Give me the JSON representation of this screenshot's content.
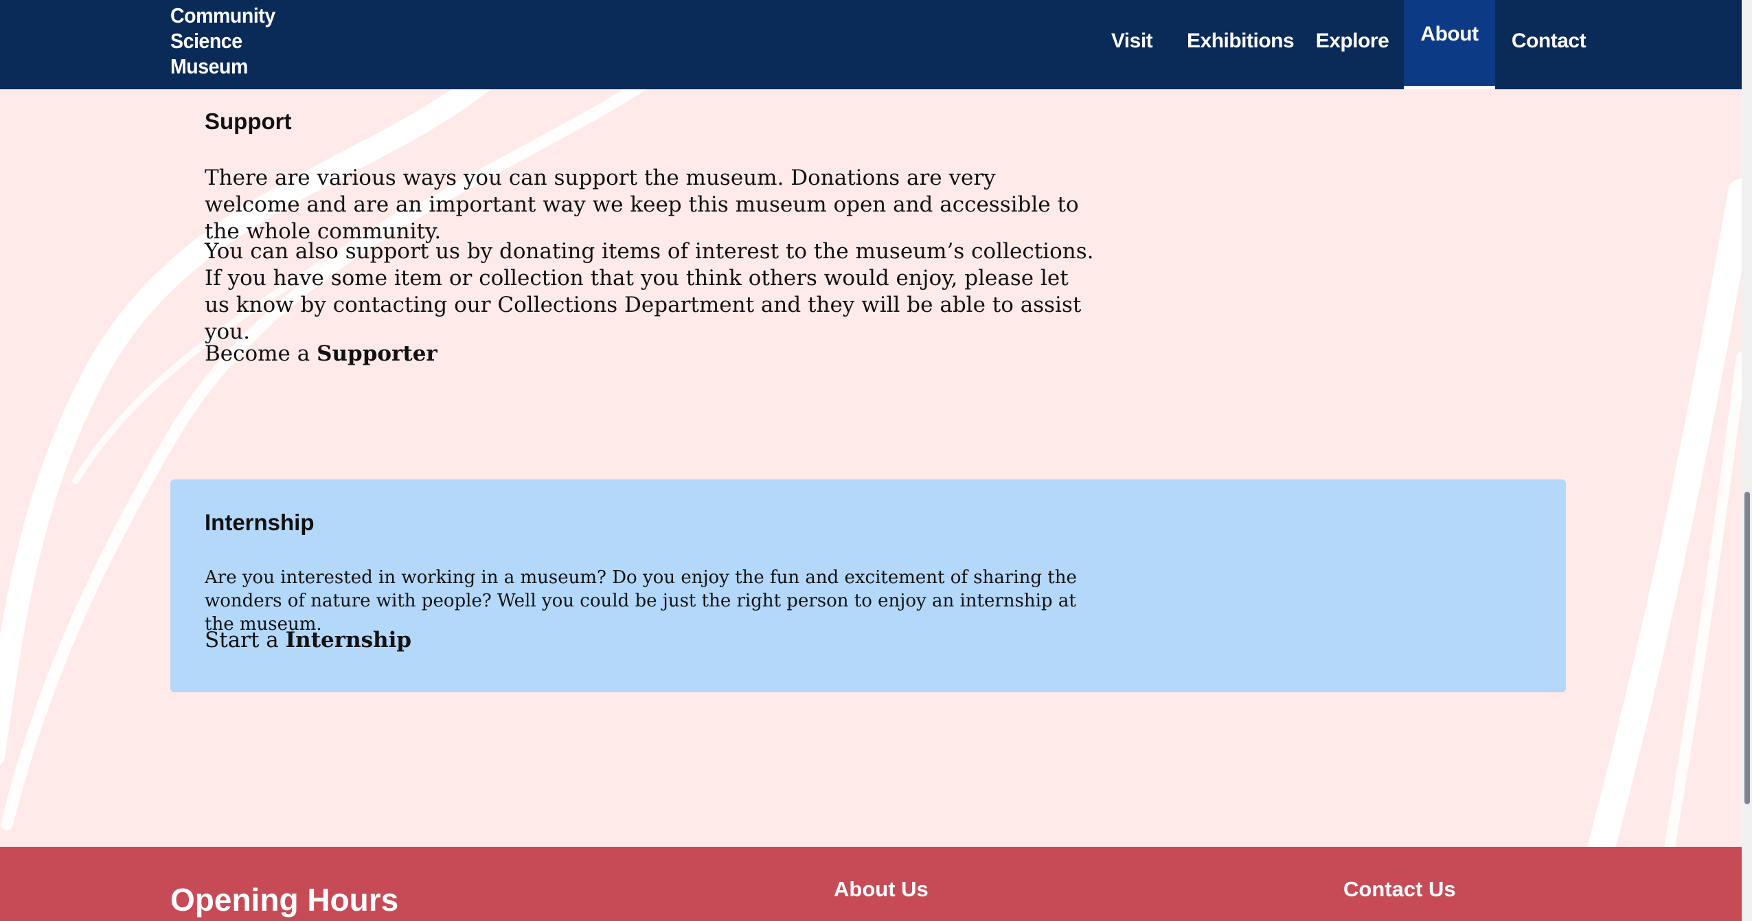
{
  "header": {
    "logo_lines": [
      "Community",
      "Science",
      "Museum"
    ],
    "nav": [
      "Visit",
      "Exhibitions",
      "Explore",
      "About",
      "Contact"
    ],
    "active_nav": "About"
  },
  "support": {
    "title": "Support",
    "para1": "There are various ways you can support the museum. Donations are very welcome and are an important way we keep this museum open and accessible to the whole community.",
    "para2": "You can also support us by donating items of interest to the museum’s collections. If you have some item or collection that you think others would enjoy, please let us know by contacting our Collections Department and they will be able to assist you.",
    "cta_prefix": "Become a ",
    "cta_link": "Supporter"
  },
  "internship": {
    "title": "Internship",
    "text": "Are you interested in working in a museum? Do you enjoy the fun and excitement of sharing the wonders of nature with people? Well you could be just the right person to enjoy an internship at the museum.",
    "cta_prefix": "Start a ",
    "cta_link": "Internship"
  },
  "footer": {
    "hours_title": "Opening Hours",
    "about_title": "About Us",
    "contact_title": "Contact Us"
  },
  "colors": {
    "header_bg": "#0a2a58",
    "nav_active": "#0d3a85",
    "page_bg": "#ffeaea",
    "intern_bg": "#b3d8fa",
    "footer_bg": "#c74b56"
  }
}
